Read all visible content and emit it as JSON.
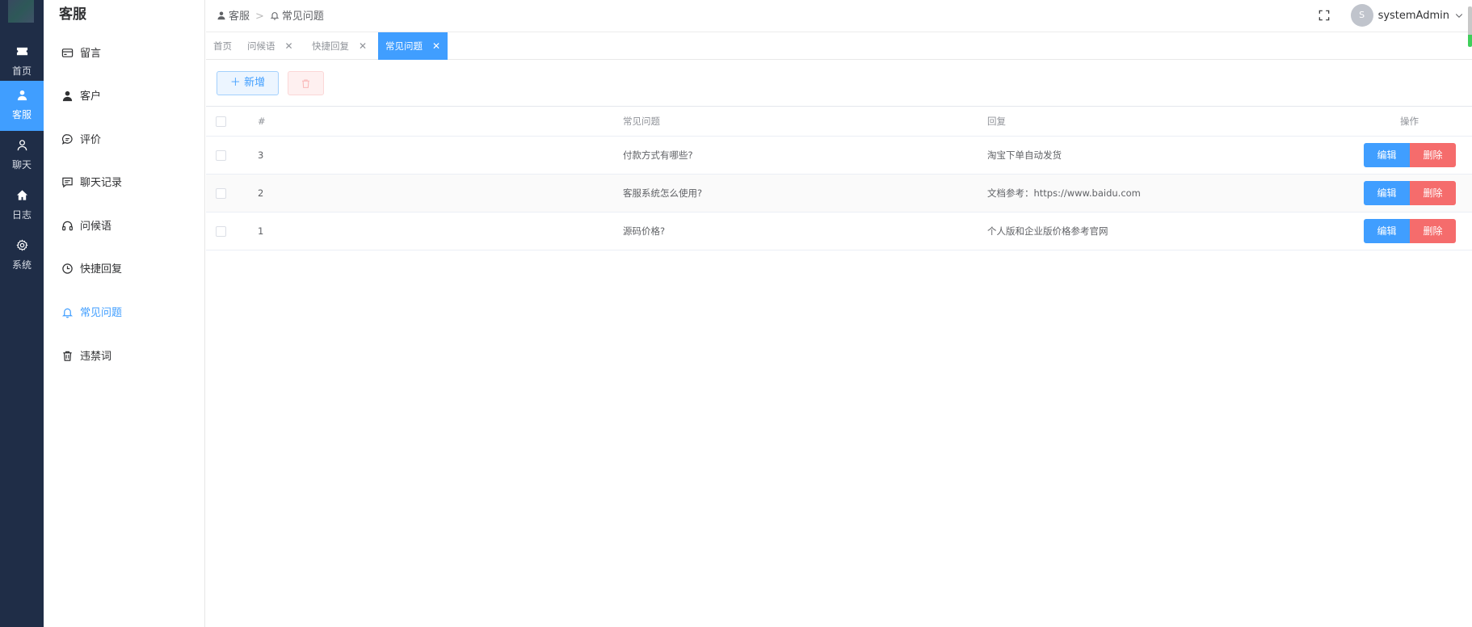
{
  "rail": {
    "items": [
      {
        "label": "首页",
        "icon": "ticket-icon"
      },
      {
        "label": "客服",
        "icon": "user-icon"
      },
      {
        "label": "聊天",
        "icon": "user-outline-icon"
      },
      {
        "label": "日志",
        "icon": "home-icon"
      },
      {
        "label": "系统",
        "icon": "gear-icon"
      }
    ]
  },
  "submenu": {
    "title": "客服",
    "items": [
      {
        "label": "留言",
        "icon": "credit-card-icon"
      },
      {
        "label": "客户",
        "icon": "user-icon"
      },
      {
        "label": "评价",
        "icon": "chat-bubble-icon"
      },
      {
        "label": "聊天记录",
        "icon": "chat-square-icon"
      },
      {
        "label": "问候语",
        "icon": "headset-icon"
      },
      {
        "label": "快捷回复",
        "icon": "clock-icon"
      },
      {
        "label": "常见问题",
        "icon": "bell-icon"
      },
      {
        "label": "违禁词",
        "icon": "trash-icon"
      }
    ]
  },
  "header": {
    "breadcrumb": [
      "客服",
      "常见问题"
    ],
    "username": "systemAdmin",
    "avatar_letter": "S"
  },
  "tabs": [
    {
      "label": "首页",
      "closable": false
    },
    {
      "label": "问候语",
      "closable": true
    },
    {
      "label": "快捷回复",
      "closable": true
    },
    {
      "label": "常见问题",
      "closable": true
    }
  ],
  "toolbar": {
    "add_label": "新增"
  },
  "table": {
    "columns": {
      "idx": "#",
      "question": "常见问题",
      "answer": "回复",
      "ops": "操作"
    },
    "rows": [
      {
        "idx": "3",
        "question": "付款方式有哪些?",
        "answer": "淘宝下单自动发货"
      },
      {
        "idx": "2",
        "question": "客服系统怎么使用?",
        "answer": "文档参考：https://www.baidu.com"
      },
      {
        "idx": "1",
        "question": "源码价格?",
        "answer": "个人版和企业版价格参考官网"
      }
    ],
    "edit_label": "编辑",
    "delete_label": "删除"
  },
  "colors": {
    "primary": "#409eff",
    "danger": "#f56c6c",
    "rail_bg": "#1f2d47"
  }
}
